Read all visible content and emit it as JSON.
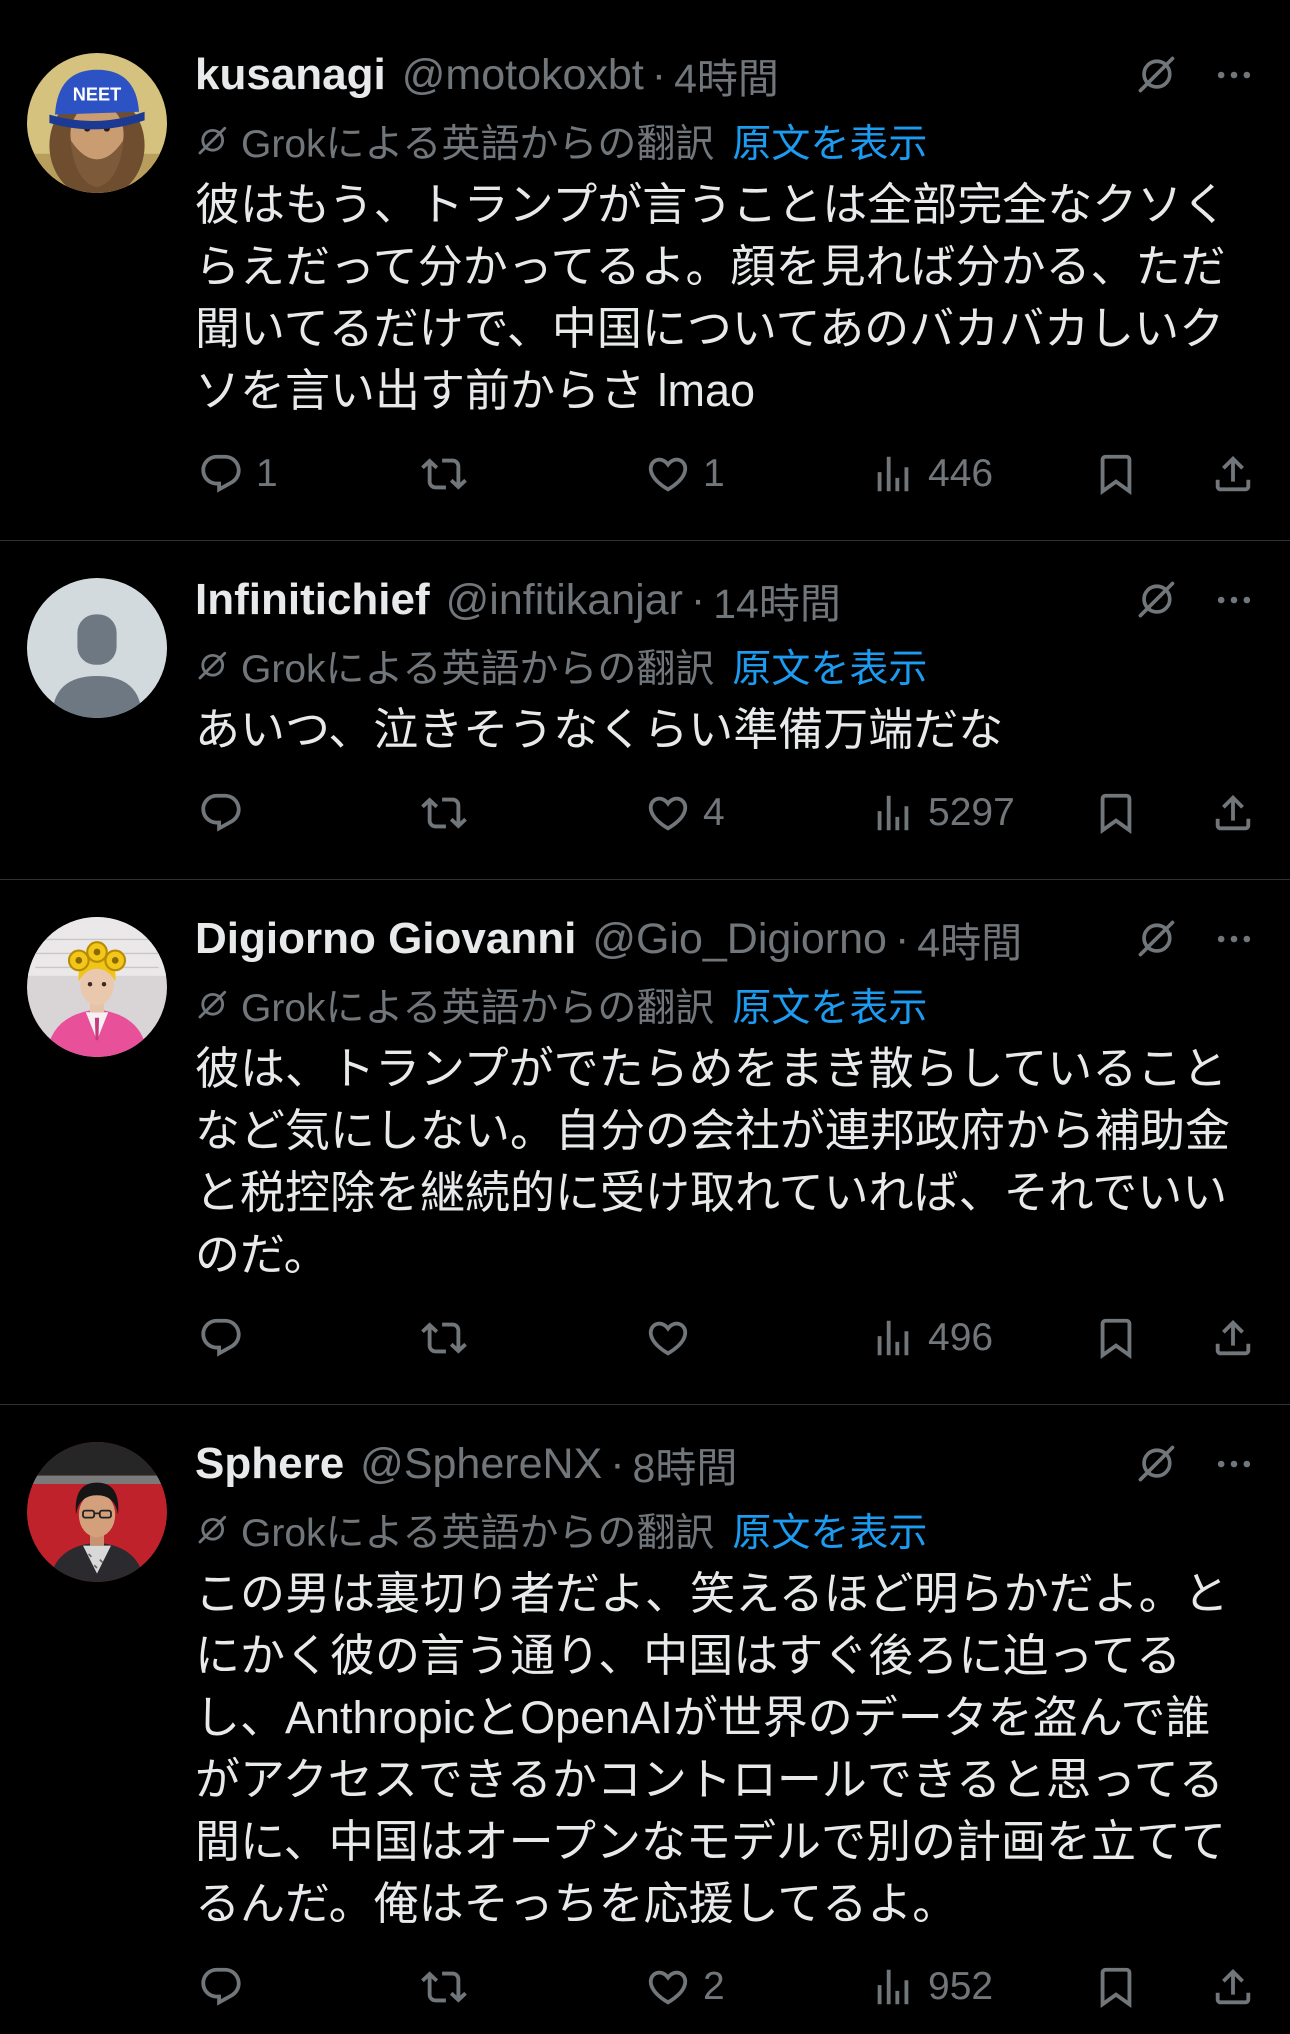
{
  "theme": {
    "background": "#000000",
    "text": "#e7e9ea",
    "secondary": "#71767b",
    "link": "#1d9bf0",
    "divider": "#2f3336"
  },
  "icons": [
    "grok-icon",
    "more-icon",
    "reply-icon",
    "retweet-icon",
    "like-icon",
    "views-icon",
    "bookmark-icon",
    "share-icon"
  ],
  "separator": "·",
  "tweets": [
    {
      "display_name": "kusanagi",
      "handle": "@motokoxbt",
      "time": "4時間",
      "translation_label": "Grokによる英語からの翻訳",
      "show_original": "原文を表示",
      "avatar_cap_text": "NEET",
      "body_lines": [
        "彼はもう、トランプが言うことは全部完全なクソく",
        "らえだって分かってるよ。顔を見れば分かる、ただ",
        "聞いてるだけで、中国についてあのバカバカしいク",
        "ソを言い出す前からさ lmao"
      ],
      "counts": {
        "replies": "1",
        "likes": "1",
        "views": "446"
      }
    },
    {
      "display_name": "Infinitichief",
      "handle": "@infitikanjar",
      "time": "14時間",
      "translation_label": "Grokによる英語からの翻訳",
      "show_original": "原文を表示",
      "body_lines": [
        "あいつ、泣きそうなくらい準備万端だな"
      ],
      "counts": {
        "likes": "4",
        "views": "5297"
      }
    },
    {
      "display_name": "Digiorno Giovanni",
      "handle": "@Gio_Digiorno",
      "time": "4時間",
      "translation_label": "Grokによる英語からの翻訳",
      "show_original": "原文を表示",
      "body_lines": [
        "彼は、トランプがでたらめをまき散らしていること",
        "など気にしない。自分の会社が連邦政府から補助金",
        "と税控除を継続的に受け取れていれば、それでいい",
        "のだ。"
      ],
      "counts": {
        "views": "496"
      }
    },
    {
      "display_name": "Sphere",
      "handle": "@SphereNX",
      "time": "8時間",
      "translation_label": "Grokによる英語からの翻訳",
      "show_original": "原文を表示",
      "body_lines": [
        "この男は裏切り者だよ、笑えるほど明らかだよ。と",
        "にかく彼の言う通り、中国はすぐ後ろに迫ってる",
        "し、AnthropicとOpenAIが世界のデータを盗んで誰",
        "がアクセスできるかコントロールできると思ってる",
        "間に、中国はオープンなモデルで別の計画を立てて",
        "るんだ。俺はそっちを応援してるよ。"
      ],
      "counts": {
        "likes": "2",
        "views": "952"
      }
    }
  ]
}
